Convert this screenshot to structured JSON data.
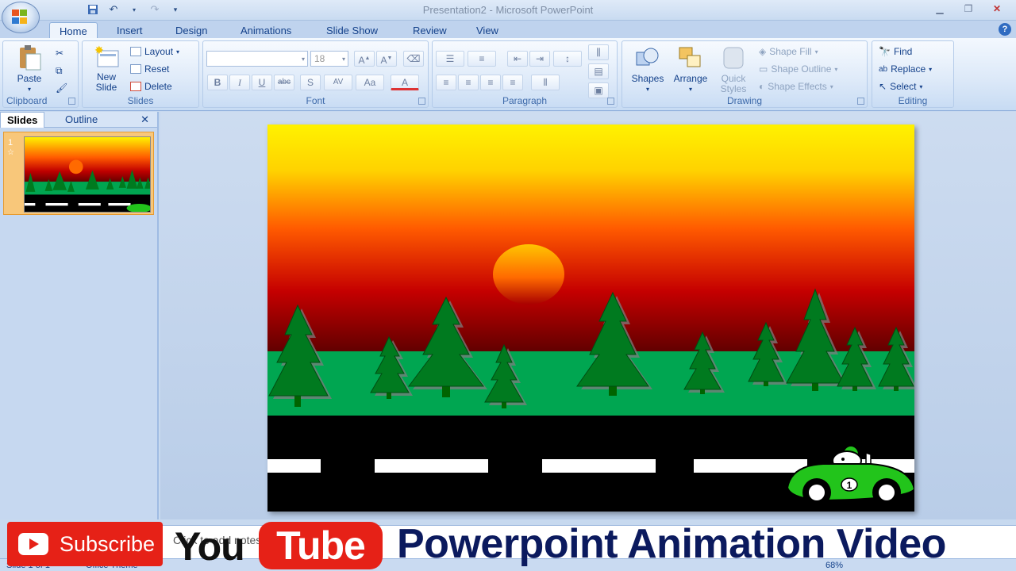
{
  "window": {
    "title": "Presentation2 - Microsoft PowerPoint"
  },
  "tabs": [
    "Home",
    "Insert",
    "Design",
    "Animations",
    "Slide Show",
    "Review",
    "View"
  ],
  "active_tab": "Home",
  "ribbon": {
    "clipboard": {
      "label": "Clipboard",
      "paste": "Paste"
    },
    "slides": {
      "label": "Slides",
      "new_slide": "New Slide",
      "layout": "Layout",
      "reset": "Reset",
      "delete": "Delete"
    },
    "font": {
      "label": "Font",
      "font_name": "",
      "font_size": "18",
      "buttons": [
        "B",
        "I",
        "U",
        "abc",
        "S",
        "AV",
        "Aa",
        "A"
      ]
    },
    "paragraph": {
      "label": "Paragraph"
    },
    "drawing": {
      "label": "Drawing",
      "shapes": "Shapes",
      "arrange": "Arrange",
      "quick_styles": "Quick Styles",
      "shape_fill": "Shape Fill",
      "shape_outline": "Shape Outline",
      "shape_effects": "Shape Effects"
    },
    "editing": {
      "label": "Editing",
      "find": "Find",
      "replace": "Replace",
      "select": "Select"
    }
  },
  "left_pane": {
    "tab_slides": "Slides",
    "tab_outline": "Outline",
    "slide_number": "1"
  },
  "notes": {
    "placeholder": "Click to add notes"
  },
  "status": {
    "slide": "Slide 1 of 1",
    "theme": "Office Theme",
    "zoom": "68%"
  },
  "banner": {
    "subscribe": "Subscribe",
    "you": "You",
    "tube": "Tube",
    "title": "Powerpoint Animation Video"
  },
  "slide_scene": {
    "car_number": "1"
  },
  "colors": {
    "sky_top": "#fff200",
    "sun": "#ff6a00",
    "grass": "#00a651",
    "road": "#000000",
    "tree": "#007a1f",
    "car": "#22c41b",
    "youtube_red": "#e62117"
  }
}
